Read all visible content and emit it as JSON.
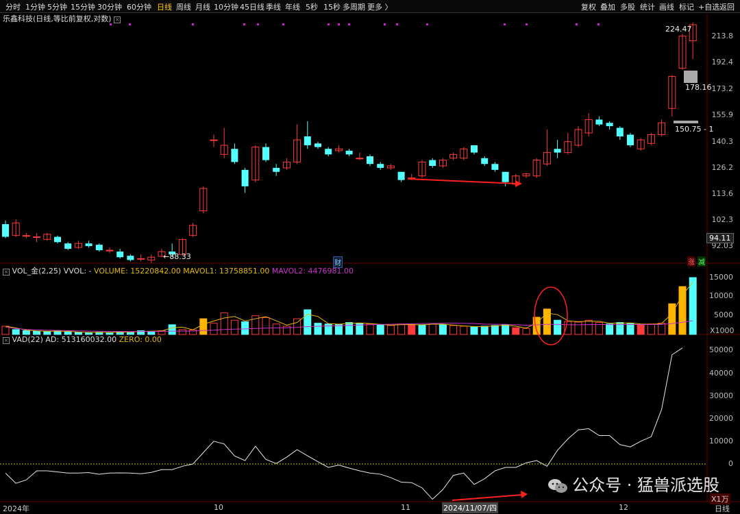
{
  "toolbar": {
    "periods": [
      "分时",
      "1分钟",
      "5分钟",
      "15分钟",
      "30分钟",
      "60分钟",
      "日线",
      "周线",
      "月线",
      "10分钟",
      "45日线",
      "季线",
      "年线",
      "5秒",
      "15秒",
      "多周期",
      "更多 〉"
    ],
    "active_period": "日线",
    "right_items": [
      "复权",
      "叠加",
      "多股",
      "统计",
      "画线",
      "标记",
      "+自选",
      "返回"
    ]
  },
  "stock_title": "乐鑫科技(日线,等比前复权,对数)",
  "price_axis": [
    "213.8",
    "192.4",
    "173.2",
    "155.9",
    "140.3",
    "126.2",
    "113.6",
    "102.3",
    "92.03"
  ],
  "current_price_tag": "94.11",
  "annotations": {
    "high": "224.47",
    "low": "88.33",
    "mid_high": "178.16",
    "mid_low": "150.75 - 1"
  },
  "event_markers": {
    "finance": "财",
    "limit_up": "涨",
    "reduce": "减"
  },
  "vol_panel": {
    "name": "VOL_金(2,25)",
    "vvol": "VVOL: -",
    "volume": "VOLUME: 15220842.00",
    "mavol1": "MAVOL1: 13758851.00",
    "mavol2": "MAVOL2: 4476981.00",
    "axis": [
      "15000",
      "10000",
      "5000"
    ],
    "unit": "X1000"
  },
  "vad_panel": {
    "name": "VAD(22)",
    "ad": "AD: 513160032.00",
    "zero": "ZERO: 0.00",
    "axis": [
      "50000",
      "40000",
      "30000",
      "20000",
      "10000",
      "0"
    ],
    "unit": "X1万"
  },
  "x_axis": {
    "labels": [
      "2024年",
      "10",
      "11",
      "12"
    ],
    "cursor_date": "2024/11/07/四",
    "period": "日线"
  },
  "watermark": "公众号 · 猛兽派选股",
  "colors": {
    "up": "#ff3b3b",
    "down": "#54ffff",
    "volume_highlight": "#ffb400",
    "mavol1": "#e6b800",
    "mavol2": "#cc33cc",
    "vad_line": "#e8e8e8",
    "zero_line": "#cccc00",
    "annotation_red": "#ff2020"
  },
  "candles": [
    {
      "o": 100.5,
      "c": 95.5,
      "h": 102,
      "l": 95
    },
    {
      "o": 96,
      "c": 101,
      "h": 102.5,
      "l": 95.5
    },
    {
      "o": 96,
      "c": 96,
      "h": 97,
      "l": 95
    },
    {
      "o": 95.5,
      "c": 95.5,
      "h": 97,
      "l": 93.5
    },
    {
      "o": 94.5,
      "c": 96.5,
      "h": 97,
      "l": 94
    },
    {
      "o": 95.5,
      "c": 93.5,
      "h": 96,
      "l": 93
    },
    {
      "o": 93,
      "c": 91,
      "h": 93.5,
      "l": 90.5
    },
    {
      "o": 91.5,
      "c": 93,
      "h": 94,
      "l": 91
    },
    {
      "o": 93,
      "c": 92,
      "h": 94,
      "l": 91.5
    },
    {
      "o": 92.5,
      "c": 90.5,
      "h": 93,
      "l": 90
    },
    {
      "o": 90.5,
      "c": 90.5,
      "h": 91.5,
      "l": 89.5
    },
    {
      "o": 90,
      "c": 88,
      "h": 91,
      "l": 87.5
    },
    {
      "o": 88.5,
      "c": 87,
      "h": 89,
      "l": 86.5
    },
    {
      "o": 87.5,
      "c": 87.5,
      "h": 89,
      "l": 86.5
    },
    {
      "o": 87,
      "c": 88,
      "h": 89,
      "l": 86
    },
    {
      "o": 88.3,
      "c": 90,
      "h": 91,
      "l": 88
    },
    {
      "o": 90,
      "c": 89,
      "h": 93,
      "l": 88
    },
    {
      "o": 89,
      "c": 94.5,
      "h": 95,
      "l": 88.5
    },
    {
      "o": 96,
      "c": 100,
      "h": 101,
      "l": 95.5
    },
    {
      "o": 106,
      "c": 116,
      "h": 117,
      "l": 105
    },
    {
      "o": 141,
      "c": 141,
      "h": 144,
      "l": 137
    },
    {
      "o": 133,
      "c": 138,
      "h": 148,
      "l": 131
    },
    {
      "o": 136,
      "c": 129,
      "h": 139,
      "l": 128
    },
    {
      "o": 125,
      "c": 117,
      "h": 126,
      "l": 114
    },
    {
      "o": 120,
      "c": 137,
      "h": 138,
      "l": 119
    },
    {
      "o": 137,
      "c": 130,
      "h": 139,
      "l": 129
    },
    {
      "o": 126,
      "c": 124,
      "h": 128,
      "l": 122
    },
    {
      "o": 126,
      "c": 129,
      "h": 131,
      "l": 125
    },
    {
      "o": 129,
      "c": 141,
      "h": 150,
      "l": 128
    },
    {
      "o": 143,
      "c": 138,
      "h": 152,
      "l": 136
    },
    {
      "o": 139,
      "c": 137,
      "h": 140,
      "l": 136
    },
    {
      "o": 136,
      "c": 133,
      "h": 137,
      "l": 132
    },
    {
      "o": 135,
      "c": 136,
      "h": 138,
      "l": 134
    },
    {
      "o": 135,
      "c": 133,
      "h": 136,
      "l": 132
    },
    {
      "o": 131,
      "c": 131,
      "h": 134,
      "l": 130
    },
    {
      "o": 132,
      "c": 128,
      "h": 133,
      "l": 127
    },
    {
      "o": 128,
      "c": 126,
      "h": 129,
      "l": 125
    },
    {
      "o": 126,
      "c": 127,
      "h": 128,
      "l": 125
    },
    {
      "o": 124,
      "c": 120,
      "h": 124,
      "l": 119
    },
    {
      "o": 121,
      "c": 121,
      "h": 123,
      "l": 120
    },
    {
      "o": 122,
      "c": 129,
      "h": 130,
      "l": 121
    },
    {
      "o": 130,
      "c": 127,
      "h": 131,
      "l": 126
    },
    {
      "o": 127,
      "c": 130,
      "h": 131,
      "l": 126
    },
    {
      "o": 131,
      "c": 133,
      "h": 134,
      "l": 130
    },
    {
      "o": 131,
      "c": 136,
      "h": 137,
      "l": 130
    },
    {
      "o": 138,
      "c": 134,
      "h": 138,
      "l": 133
    },
    {
      "o": 131,
      "c": 128,
      "h": 132,
      "l": 127
    },
    {
      "o": 128,
      "c": 125,
      "h": 129,
      "l": 124
    },
    {
      "o": 124,
      "c": 119,
      "h": 124,
      "l": 117
    },
    {
      "o": 118,
      "c": 122,
      "h": 123,
      "l": 117.5
    },
    {
      "o": 122,
      "c": 123,
      "h": 123.5,
      "l": 121
    },
    {
      "o": 122,
      "c": 130,
      "h": 131,
      "l": 121
    },
    {
      "o": 128,
      "c": 134,
      "h": 147,
      "l": 127
    },
    {
      "o": 136,
      "c": 134,
      "h": 141,
      "l": 131
    },
    {
      "o": 134,
      "c": 140,
      "h": 145,
      "l": 133
    },
    {
      "o": 138,
      "c": 147,
      "h": 149,
      "l": 137
    },
    {
      "o": 145,
      "c": 153,
      "h": 157,
      "l": 143
    },
    {
      "o": 153,
      "c": 150,
      "h": 155,
      "l": 149
    },
    {
      "o": 151,
      "c": 149,
      "h": 152,
      "l": 147
    },
    {
      "o": 148,
      "c": 143,
      "h": 149,
      "l": 141
    },
    {
      "o": 144,
      "c": 138,
      "h": 145,
      "l": 137
    },
    {
      "o": 136,
      "c": 141,
      "h": 142,
      "l": 135
    },
    {
      "o": 139,
      "c": 144,
      "h": 145,
      "l": 138
    },
    {
      "o": 144,
      "c": 151,
      "h": 153,
      "l": 143
    },
    {
      "o": 160,
      "c": 182,
      "h": 183,
      "l": 155
    },
    {
      "o": 188,
      "c": 214,
      "h": 216,
      "l": 187
    },
    {
      "o": 210,
      "c": 224,
      "h": 226,
      "l": 195
    }
  ],
  "volumes": [
    2.2,
    1.3,
    1.0,
    0.9,
    0.8,
    1.0,
    0.7,
    0.6,
    0.5,
    0.6,
    0.5,
    0.7,
    0.6,
    1.0,
    0.8,
    1.0,
    2.6,
    1.3,
    1.2,
    4.2,
    3.0,
    5.8,
    3.8,
    3.4,
    5.0,
    4.5,
    2.8,
    2.2,
    4.2,
    6.6,
    3.0,
    2.8,
    2.7,
    3.2,
    3.0,
    2.8,
    2.6,
    2.4,
    2.8,
    2.5,
    2.6,
    2.9,
    2.6,
    2.4,
    2.2,
    2.0,
    2.2,
    2.4,
    2.6,
    1.8,
    1.6,
    4.6,
    6.8,
    3.8,
    3.5,
    3.3,
    3.8,
    3.2,
    2.8,
    3.2,
    3.0,
    2.6,
    2.8,
    3.0,
    8.2,
    12.8,
    15.2
  ],
  "volume_colors": [
    "u",
    "d",
    "d",
    "d",
    "d",
    "d",
    "d",
    "d",
    "d",
    "d",
    "d",
    "d",
    "d",
    "d",
    "d",
    "u",
    "d",
    "u",
    "u",
    "h",
    "u",
    "u",
    "u",
    "d",
    "u",
    "u",
    "u",
    "u",
    "u",
    "d",
    "d",
    "d",
    "d",
    "d",
    "d",
    "u",
    "d",
    "u",
    "u",
    "s",
    "d",
    "u",
    "d",
    "u",
    "u",
    "d",
    "d",
    "d",
    "d",
    "s",
    "u",
    "h",
    "h",
    "d",
    "u",
    "u",
    "u",
    "u",
    "d",
    "d",
    "d",
    "s",
    "u",
    "u",
    "h",
    "h",
    "d"
  ],
  "vad_line": [
    -4000,
    -8500,
    -7000,
    -3000,
    -3000,
    -3500,
    -4000,
    -4000,
    -3800,
    -4500,
    -4000,
    -3900,
    -4000,
    -4300,
    -3700,
    -2500,
    -2500,
    -1000,
    0,
    5000,
    10000,
    8800,
    3500,
    1500,
    7800,
    2000,
    200,
    3000,
    6300,
    3600,
    1000,
    -1500,
    -500,
    -1800,
    -3000,
    -4000,
    -4500,
    -6000,
    -8000,
    -8200,
    -10500,
    -15500,
    -11200,
    -5000,
    -4000,
    -9000,
    -6500,
    -3000,
    -1500,
    -1500,
    500,
    1500,
    -1000,
    6000,
    11000,
    15000,
    15500,
    12500,
    12500,
    8500,
    7500,
    10000,
    12000,
    24000,
    48000,
    51000
  ]
}
